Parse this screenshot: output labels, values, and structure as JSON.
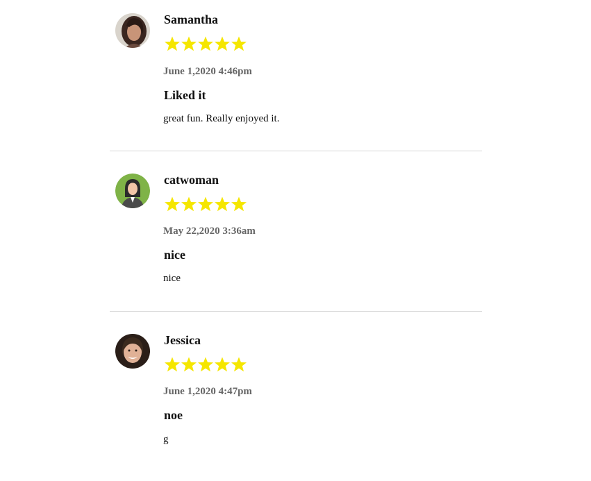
{
  "reviews": [
    {
      "name": "Samantha",
      "avatar_icon": "user-photo-avatar",
      "rating": 5,
      "rating_max": 5,
      "date": "June 1,2020 4:46pm",
      "title": "Liked it",
      "text": "great fun. Really enjoyed it."
    },
    {
      "name": "catwoman",
      "avatar_icon": "user-illustration-avatar",
      "rating": 5,
      "rating_max": 5,
      "date": "May 22,2020 3:36am",
      "title": "nice",
      "text": "nice"
    },
    {
      "name": "Jessica",
      "avatar_icon": "user-photo-avatar",
      "rating": 5,
      "rating_max": 5,
      "date": "June 1,2020 4:47pm",
      "title": "noe",
      "text": "g"
    }
  ],
  "colors": {
    "star": "#f5e600",
    "divider": "#d6d6d6",
    "date_text": "#666666",
    "text": "#111111"
  }
}
